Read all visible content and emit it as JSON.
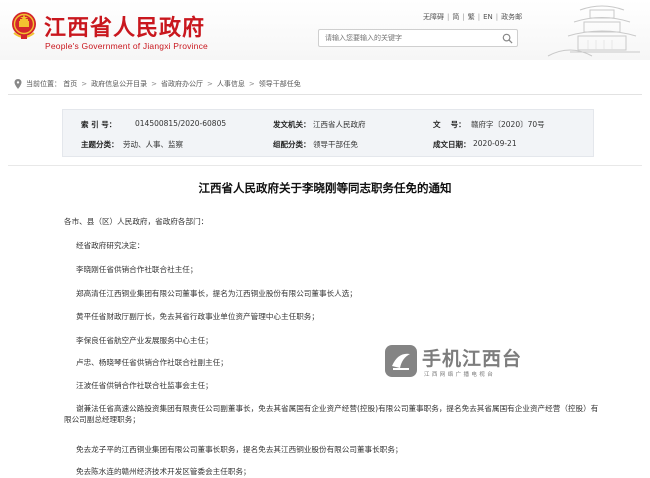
{
  "header": {
    "title": "江西省人民政府",
    "subtitle": "People's Government of Jiangxi Province",
    "links": [
      "无障碍",
      "简",
      "繁",
      "EN",
      "政务邮"
    ],
    "search_placeholder": "请输入您要输入的关键字",
    "colors": {
      "brand_red": "#c9171e"
    }
  },
  "breadcrumb": {
    "label": "当前位置：",
    "items": [
      "首页",
      "政府信息公开目录",
      "省政府办公厅",
      "人事信息",
      "领导干部任免"
    ]
  },
  "meta": {
    "index_key": "索 引 号：",
    "index_val": "014500815/2020-60805",
    "org_key": "发文机关：",
    "org_val": "江西省人民政府",
    "doc_key": "文　 号：",
    "doc_val": "赣府字〔2020〕70号",
    "subject_key": "主题分类：",
    "subject_val": "劳动、人事、监察",
    "category_key": "组配分类：",
    "category_val": "领导干部任免",
    "date_key": "成文日期：",
    "date_val": "2020-09-21"
  },
  "article": {
    "title": "江西省人民政府关于李晓刚等同志职务任免的通知",
    "salutation": "各市、县（区）人民政府，省政府各部门：",
    "paragraphs": [
      "经省政府研究决定：",
      "李晓刚任省供销合作社联合社主任；",
      "郑高清任江西铜业集团有限公司董事长，提名为江西铜业股份有限公司董事长人选；",
      "黄平任省财政厅副厅长，免去其省行政事业单位资产管理中心主任职务；",
      "李保良任省航空产业发展服务中心主任；",
      "卢忠、杨晓琴任省供销合作社联合社副主任；",
      "汪波任省供销合作社联合社监事会主任；",
      "谢兼法任省高速公路投资集团有限责任公司副董事长，免去其省属国有企业资产经营(控股)有限公司董事职务，提名免去其省属国有企业资产经营（控股）有限公司副总经理职务；",
      "免去龙子平的江西铜业集团有限公司董事长职务，提名免去其江西铜业股份有限公司董事长职务；",
      "免去陈水连的赣州经济技术开发区管委会主任职务；"
    ]
  },
  "watermark": {
    "name": "手机江西台",
    "tagline": "江西网络广播电视台"
  }
}
